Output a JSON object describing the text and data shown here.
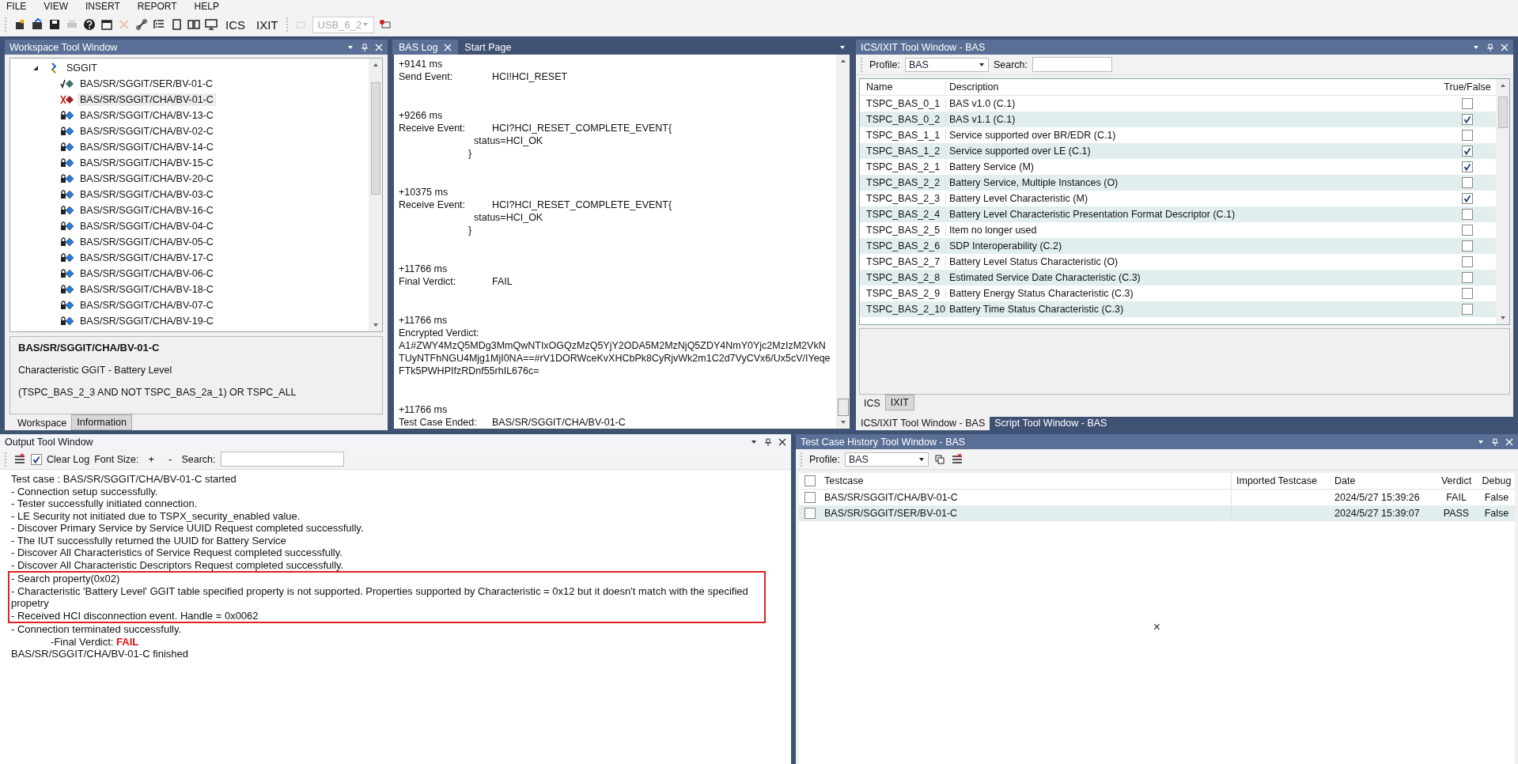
{
  "menu": [
    "FILE",
    "VIEW",
    "INSERT",
    "REPORT",
    "HELP"
  ],
  "toolbar": {
    "text_buttons": [
      "ICS",
      "IXIT"
    ],
    "device": "USB_6_2"
  },
  "workspace": {
    "title": "Workspace Tool Window",
    "tree": {
      "label": "SGGIT",
      "expanded": true,
      "children": [
        {
          "label": "BAS/SR/SGGIT/SER/BV-01-C",
          "kind": "pass",
          "selected": false
        },
        {
          "label": "BAS/SR/SGGIT/CHA/BV-01-C",
          "kind": "fail",
          "selected": true
        },
        {
          "label": "BAS/SR/SGGIT/CHA/BV-13-C",
          "kind": "locked",
          "selected": false
        },
        {
          "label": "BAS/SR/SGGIT/CHA/BV-02-C",
          "kind": "locked",
          "selected": false
        },
        {
          "label": "BAS/SR/SGGIT/CHA/BV-14-C",
          "kind": "locked",
          "selected": false
        },
        {
          "label": "BAS/SR/SGGIT/CHA/BV-15-C",
          "kind": "locked",
          "selected": false
        },
        {
          "label": "BAS/SR/SGGIT/CHA/BV-20-C",
          "kind": "locked",
          "selected": false
        },
        {
          "label": "BAS/SR/SGGIT/CHA/BV-03-C",
          "kind": "locked",
          "selected": false
        },
        {
          "label": "BAS/SR/SGGIT/CHA/BV-16-C",
          "kind": "locked",
          "selected": false
        },
        {
          "label": "BAS/SR/SGGIT/CHA/BV-04-C",
          "kind": "locked",
          "selected": false
        },
        {
          "label": "BAS/SR/SGGIT/CHA/BV-05-C",
          "kind": "locked",
          "selected": false
        },
        {
          "label": "BAS/SR/SGGIT/CHA/BV-17-C",
          "kind": "locked",
          "selected": false
        },
        {
          "label": "BAS/SR/SGGIT/CHA/BV-06-C",
          "kind": "locked",
          "selected": false
        },
        {
          "label": "BAS/SR/SGGIT/CHA/BV-18-C",
          "kind": "locked",
          "selected": false
        },
        {
          "label": "BAS/SR/SGGIT/CHA/BV-07-C",
          "kind": "locked",
          "selected": false
        },
        {
          "label": "BAS/SR/SGGIT/CHA/BV-19-C",
          "kind": "locked",
          "selected": false
        }
      ]
    },
    "info": {
      "title": "BAS/SR/SGGIT/CHA/BV-01-C",
      "description": "Characteristic GGIT - Battery Level",
      "condition": "(TSPC_BAS_2_3 AND NOT TSPC_BAS_2a_1) OR TSPC_ALL"
    },
    "tabs": [
      {
        "label": "Workspace",
        "selected": true
      },
      {
        "label": "Information",
        "selected": false
      }
    ]
  },
  "log": {
    "tabs": [
      {
        "label": "BAS Log",
        "selected": true,
        "closable": true
      },
      {
        "label": "Start Page",
        "selected": false,
        "closable": false
      }
    ],
    "entries": [
      {
        "time": "+9141 ms",
        "event": "Send Event:",
        "value": "HCI!HCI_RESET",
        "kind": "inline"
      },
      {
        "time": "+9266 ms",
        "event": "Receive Event:",
        "value": "HCI?HCI_RESET_COMPLETE_EVENT{",
        "kind": "inline",
        "detail": [
          "status=HCI_OK",
          "}"
        ]
      },
      {
        "time": "+10375 ms",
        "event": "Receive Event:",
        "value": "HCI?HCI_RESET_COMPLETE_EVENT{",
        "kind": "inline",
        "detail": [
          "status=HCI_OK",
          "}"
        ]
      },
      {
        "time": "+11766 ms",
        "event": "Final Verdict:",
        "value": "FAIL",
        "kind": "inline"
      },
      {
        "time": "+11766 ms",
        "event": "Encrypted Verdict:",
        "value": "A1#ZWY4MzQ5MDg3MmQwNTIxOGQzMzQ5YjY2ODA5M2MzNjQ5ZDY4NmY0Yjc2MzIzM2VkNTUyNTFhNGU4Mjg1MjI0NA==#rV1DORWceKvXHCbPk8CyRjvWk2m1C2d7VyCVx6/Ux5cV/IYeqeFTk5PWHPIfzRDnf55rhIL676c=",
        "kind": "block"
      },
      {
        "time": "+11766 ms",
        "event": "Test Case Ended:",
        "value": "BAS/SR/SGGIT/CHA/BV-01-C",
        "kind": "inline"
      }
    ]
  },
  "ics": {
    "title": "ICS/IXIT Tool Window - BAS",
    "profile_label": "Profile:",
    "profile": "BAS",
    "search_label": "Search:",
    "columns": [
      "Name",
      "Description",
      "True/False"
    ],
    "rows": [
      {
        "name": "TSPC_BAS_0_1",
        "description": "BAS v1.0 (C.1)",
        "checked": false
      },
      {
        "name": "TSPC_BAS_0_2",
        "description": "BAS v1.1 (C.1)",
        "checked": true
      },
      {
        "name": "TSPC_BAS_1_1",
        "description": "Service supported over BR/EDR (C.1)",
        "checked": false
      },
      {
        "name": "TSPC_BAS_1_2",
        "description": "Service supported over LE (C.1)",
        "checked": true
      },
      {
        "name": "TSPC_BAS_2_1",
        "description": "Battery Service (M)",
        "checked": true
      },
      {
        "name": "TSPC_BAS_2_2",
        "description": "Battery Service, Multiple Instances (O)",
        "checked": false
      },
      {
        "name": "TSPC_BAS_2_3",
        "description": "Battery Level Characteristic (M)",
        "checked": true
      },
      {
        "name": "TSPC_BAS_2_4",
        "description": "Battery Level Characteristic Presentation Format Descriptor (C.1)",
        "checked": false
      },
      {
        "name": "TSPC_BAS_2_5",
        "description": "Item no longer used",
        "checked": false
      },
      {
        "name": "TSPC_BAS_2_6",
        "description": "SDP Interoperability (C.2)",
        "checked": false
      },
      {
        "name": "TSPC_BAS_2_7",
        "description": "Battery Level Status Characteristic (O)",
        "checked": false
      },
      {
        "name": "TSPC_BAS_2_8",
        "description": "Estimated Service Date Characteristic (C.3)",
        "checked": false
      },
      {
        "name": "TSPC_BAS_2_9",
        "description": "Battery Energy Status Characteristic (C.3)",
        "checked": false
      },
      {
        "name": "TSPC_BAS_2_10",
        "description": "Battery Time Status Characteristic (C.3)",
        "checked": false
      }
    ],
    "tabs": [
      {
        "label": "ICS",
        "selected": true
      },
      {
        "label": "IXIT",
        "selected": false
      }
    ],
    "window_tabs": [
      {
        "label": "ICS/IXIT Tool Window - BAS",
        "selected": true
      },
      {
        "label": "Script Tool Window - BAS",
        "selected": false
      }
    ]
  },
  "output": {
    "title": "Output Tool Window",
    "focused": true,
    "clear_log": {
      "label": "Clear Log",
      "checked": true
    },
    "font_size_label": "Font Size:",
    "font_plus": "+",
    "font_minus": "-",
    "search_label": "Search:",
    "lines": [
      {
        "text": "Test case : BAS/SR/SGGIT/CHA/BV-01-C started",
        "kind": "plain",
        "highlighted": false
      },
      {
        "text": "- Connection setup successfully.",
        "kind": "plain",
        "highlighted": false
      },
      {
        "text": "- Tester successfully initiated connection.",
        "kind": "plain",
        "highlighted": false
      },
      {
        "text": "- LE Security not initiated due to TSPX_security_enabled value.",
        "kind": "plain",
        "highlighted": false
      },
      {
        "text": "- Discover Primary Service by Service UUID Request completed successfully.",
        "kind": "plain",
        "highlighted": false
      },
      {
        "text": "- The IUT successfully returned the UUID for Battery Service",
        "kind": "plain",
        "highlighted": false
      },
      {
        "text": "- Discover All Characteristics of Service Request completed successfully.",
        "kind": "plain",
        "highlighted": false
      },
      {
        "text": "- Discover All Characteristic Descriptors Request completed successfully.",
        "kind": "plain",
        "highlighted": false
      },
      {
        "text": "- Search property(0x02)",
        "kind": "plain",
        "highlighted": true
      },
      {
        "text": "- Characteristic 'Battery Level' GGIT table specified property is not supported. Properties supported by Characteristic = 0x12 but it doesn't match with the specified propetry",
        "kind": "plain",
        "highlighted": true
      },
      {
        "text": "- Received HCI disconnection event. Handle = 0x0062",
        "kind": "plain",
        "highlighted": true
      },
      {
        "text": "- Connection terminated successfully.",
        "kind": "plain",
        "highlighted": false
      },
      {
        "text": "-Final Verdict:",
        "value": "FAIL",
        "kind": "verdict",
        "highlighted": false
      },
      {
        "text": "BAS/SR/SGGIT/CHA/BV-01-C finished",
        "kind": "plain",
        "highlighted": false
      }
    ]
  },
  "history": {
    "title": "Test Case History Tool Window - BAS",
    "focused": false,
    "profile_label": "Profile:",
    "profile": "BAS",
    "columns": [
      "Testcase",
      "Imported Testcase",
      "Date",
      "Verdict",
      "Debug"
    ],
    "rows": [
      {
        "testcase": "BAS/SR/SGGIT/CHA/BV-01-C",
        "date": "2024/5/27 15:39:26",
        "verdict": "FAIL",
        "debug": "False",
        "checked": false
      },
      {
        "testcase": "BAS/SR/SGGIT/SER/BV-01-C",
        "date": "2024/5/27 15:39:07",
        "verdict": "PASS",
        "debug": "False",
        "checked": false
      }
    ],
    "all_checked": false,
    "cursor_mark": "×"
  }
}
